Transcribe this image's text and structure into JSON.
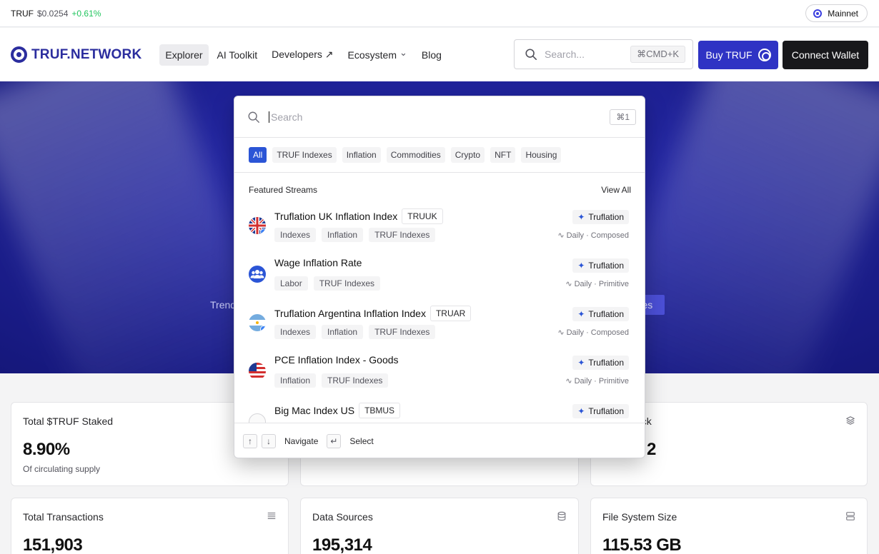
{
  "ticker": {
    "symbol": "TRUF",
    "price": "$0.0254",
    "change": "+0.61%"
  },
  "network": {
    "label": "Mainnet"
  },
  "brand": {
    "name": "TRUF.NETWORK"
  },
  "nav": {
    "links": [
      "Explorer",
      "AI Toolkit",
      "Developers ↗",
      "Ecosystem",
      "Blog"
    ],
    "ecosystem_chevron": "⌄",
    "search_placeholder": "Search...",
    "search_shortcut": "⌘CMD+K",
    "buy_label": "Buy TRUF",
    "connect_label": "Connect Wallet"
  },
  "hero": {
    "left_text": "Trend",
    "right_text": "ures"
  },
  "cards": [
    {
      "title": "Total $TRUF Staked",
      "value": "8.90%",
      "sub": "Of circulating supply",
      "icon": ""
    },
    {
      "title": "",
      "value": "",
      "sub": "",
      "icon": ""
    },
    {
      "title": "ock",
      "value": "2",
      "sub": "",
      "icon": "layers-icon"
    },
    {
      "title": "Total Transactions",
      "value": "151,903",
      "sub": "",
      "icon": "list-icon"
    },
    {
      "title": "Data Sources",
      "value": "195,314",
      "sub": "",
      "icon": "database-icon"
    },
    {
      "title": "File System Size",
      "value": "115.53 GB",
      "sub": "",
      "icon": "server-icon"
    }
  ],
  "modal": {
    "search_placeholder": "Search",
    "shortcut": "⌘1",
    "filters": [
      "All",
      "TRUF Indexes",
      "Inflation",
      "Commodities",
      "Crypto",
      "NFT",
      "Housing"
    ],
    "active_filter": "All",
    "section_title": "Featured Streams",
    "view_all": "View All",
    "streams": [
      {
        "title": "Truflation UK Inflation Index",
        "ticker": "TRUUK",
        "tags": [
          "Indexes",
          "Inflation",
          "TRUF Indexes"
        ],
        "provider": "Truflation",
        "freq": "Daily · Composed",
        "icon": "uk-flag-icon"
      },
      {
        "title": "Wage Inflation Rate",
        "ticker": "",
        "tags": [
          "Labor",
          "TRUF Indexes"
        ],
        "provider": "Truflation",
        "freq": "Daily · Primitive",
        "icon": "people-icon"
      },
      {
        "title": "Truflation Argentina Inflation Index",
        "ticker": "TRUAR",
        "tags": [
          "Indexes",
          "Inflation",
          "TRUF Indexes"
        ],
        "provider": "Truflation",
        "freq": "Daily · Composed",
        "icon": "argentina-flag-icon"
      },
      {
        "title": "PCE Inflation Index - Goods",
        "ticker": "",
        "tags": [
          "Inflation",
          "TRUF Indexes"
        ],
        "provider": "Truflation",
        "freq": "Daily · Primitive",
        "icon": "us-flag-icon"
      },
      {
        "title": "Big Mac Index US",
        "ticker": "TBMUS",
        "tags": [],
        "provider": "Truflation",
        "freq": "",
        "icon": "generic-icon"
      }
    ],
    "footer": {
      "navigate": "Navigate",
      "select": "Select",
      "up_key": "↑",
      "down_key": "↓",
      "enter_key": "↵"
    }
  }
}
